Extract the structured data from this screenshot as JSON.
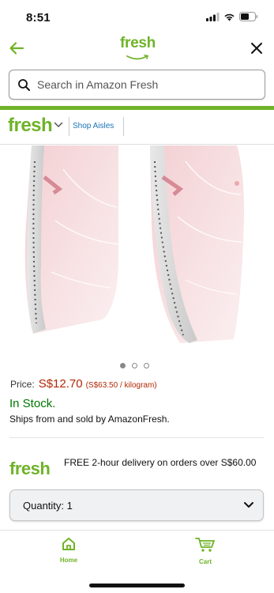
{
  "status_bar": {
    "time": "8:51"
  },
  "header": {
    "logo_text": "fresh",
    "back_icon": "arrow-left-icon",
    "close_icon": "close-icon"
  },
  "search": {
    "placeholder": "Search in Amazon Fresh"
  },
  "store_bar": {
    "logo_text": "fresh",
    "shop_aisles": "Shop Aisles"
  },
  "product": {
    "image_description_icon": "fish-fillet-image",
    "carousel": {
      "total": 3,
      "active": 1
    },
    "price_label": "Price:",
    "price": "S$12.70",
    "unit_price": "(S$63.50 / kilogram)",
    "stock": "In Stock.",
    "ships": "Ships from and sold by AmazonFresh."
  },
  "delivery": {
    "logo_text": "fresh",
    "text": "FREE 2-hour delivery on orders over S$60.00"
  },
  "quantity": {
    "label": "Quantity: 1"
  },
  "bottom_nav": {
    "items": [
      {
        "label": "Home",
        "icon": "home-icon"
      },
      {
        "label": "Cart",
        "icon": "cart-icon"
      }
    ]
  },
  "colors": {
    "brand_green": "#6fb328",
    "price_red": "#b12704",
    "stock_green": "#007600",
    "link_blue": "#1a73b8"
  }
}
